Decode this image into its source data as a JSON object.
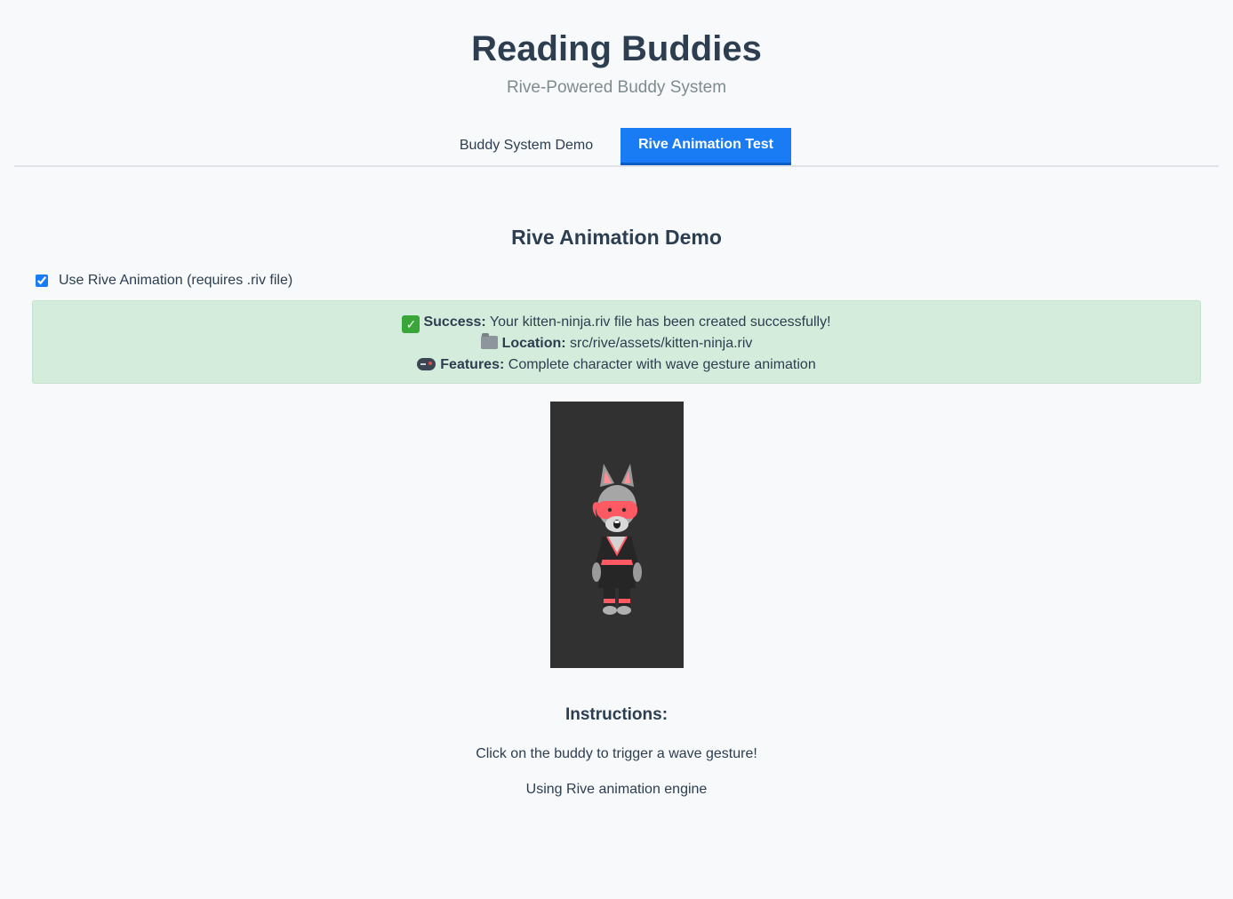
{
  "header": {
    "title": "Reading Buddies",
    "subtitle": "Rive-Powered Buddy System"
  },
  "tabs": [
    {
      "label": "Buddy System Demo",
      "active": false
    },
    {
      "label": "Rive Animation Test",
      "active": true
    }
  ],
  "main": {
    "section_title": "Rive Animation Demo",
    "rive_checkbox": {
      "label": "Use Rive Animation (requires .riv file)",
      "checked": true
    },
    "status": {
      "success_label": "Success:",
      "success_text": "Your kitten-ninja.riv file has been created successfully!",
      "success_icon": "check-mark-icon",
      "location_label": "Location:",
      "location_text": "src/rive/assets/kitten-ninja.riv",
      "location_icon": "folder-icon",
      "features_label": "Features:",
      "features_text": "Complete character with wave gesture animation",
      "features_icon": "gamepad-icon"
    },
    "buddy_canvas": {
      "character": "kitten-ninja",
      "background_color": "#313131"
    },
    "instructions": {
      "title": "Instructions:",
      "lines": [
        "Click on the buddy to trigger a wave gesture!",
        "Using Rive animation engine"
      ]
    }
  },
  "colors": {
    "accent": "#1a7cf5",
    "success_bg": "#d4ecdb",
    "text": "#2c3e50",
    "muted": "#7f8c8d",
    "ninja_red": "#ff5a63"
  }
}
